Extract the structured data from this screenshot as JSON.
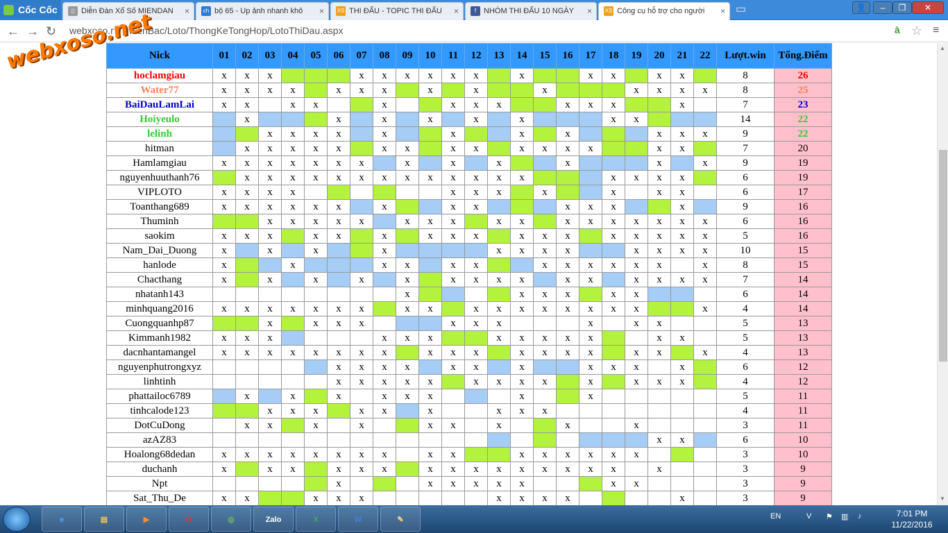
{
  "browser": {
    "logo": "Cốc Cốc",
    "tabs": [
      {
        "title": "Diễn Đàn Xổ Số MIENDAN",
        "icon": "page-icon"
      },
      {
        "title": "bộ 65 - Up ảnh nhanh khô",
        "icon": "ch-icon"
      },
      {
        "title": "THI ĐẤU - TOPIC THI ĐẤU",
        "icon": "xs-icon"
      },
      {
        "title": "NHÓM THI ĐẤU 10 NGÀY",
        "icon": "facebook-icon"
      },
      {
        "title": "Công cụ hỗ trợ cho người",
        "icon": "xs-icon"
      }
    ],
    "url": "webxoso.net/MienBac/Loto/ThongKeTongHop/LotoThiDau.aspx",
    "watermark": "webxoso.net"
  },
  "table": {
    "headers": [
      "Nick",
      "01",
      "02",
      "03",
      "04",
      "05",
      "06",
      "07",
      "08",
      "09",
      "10",
      "11",
      "12",
      "13",
      "14",
      "15",
      "16",
      "17",
      "18",
      "19",
      "20",
      "21",
      "22",
      "Lượt.win",
      "Tổng.Điểm"
    ],
    "rows": [
      {
        "nick": "hoclamgiau",
        "color": "#ff0000",
        "cells": "xxxgggxxxxxxgxggxxgxxg",
        "win": "8",
        "pts": "26"
      },
      {
        "nick": "Water77",
        "color": "#ff7f50",
        "cells": "xxxxgxxxgxgxggxgggxxxx",
        "win": "8",
        "pts": "25"
      },
      {
        "nick": "BaiDauLamLai",
        "color": "#0000cc",
        "cells": "xx xx gx gxxxggxxxggx",
        "win": "7",
        "pts": "23"
      },
      {
        "nick": "Hoiyeulo",
        "color": "#33cc33",
        "cells": "bxbbgxbxbxbxbxbbbxxgbb",
        "win": "14",
        "pts": "22"
      },
      {
        "nick": "lelinh",
        "color": "#33cc33",
        "cells": "bgxxxxbxbgxgbxgxbgbxxx",
        "win": "9",
        "pts": "22"
      },
      {
        "nick": "hitman",
        "color": "#000",
        "cells": "bxxxxxgxxgxxgxxxxggxxg",
        "win": "7",
        "pts": "20"
      },
      {
        "nick": "Hamlamgiau",
        "color": "#000",
        "cells": "xxxxxxxbxbxbxgbxbbbxbx",
        "win": "9",
        "pts": "19"
      },
      {
        "nick": "nguyenhuuthanh76",
        "color": "#000",
        "cells": "gxxxxxxxxxxxxxggbxxxxg",
        "win": "6",
        "pts": "19"
      },
      {
        "nick": "VIPLOTO",
        "color": "#000",
        "cells": "xxxx g g  xxxgxgbx xx",
        "win": "6",
        "pts": "17"
      },
      {
        "nick": "Toanthang689",
        "color": "#000",
        "cells": "xxxxxxbxgbxxbgbxxxbgxb",
        "win": "9",
        "pts": "16"
      },
      {
        "nick": "Thuminh",
        "color": "#000",
        "cells": "ggxxxxxbxxxgxxgxxxxxxx",
        "win": "6",
        "pts": "16"
      },
      {
        "nick": "saokim",
        "color": "#000",
        "cells": "xxxgxxgxgxxxgxxxgxxxxx",
        "win": "5",
        "pts": "16"
      },
      {
        "nick": "Nam_Dai_Duong",
        "color": "#000",
        "cells": "xbxbxbgxbbbbxxxxbbxxxx",
        "win": "10",
        "pts": "15"
      },
      {
        "nick": "hanlode",
        "color": "#000",
        "cells": "xgbxbbbxxbxxgbxxxxxx x",
        "win": "8",
        "pts": "15"
      },
      {
        "nick": "Chacthang",
        "color": "#000",
        "cells": "xgxbxbxbxgxxxxbxxbxxxx",
        "win": "7",
        "pts": "14"
      },
      {
        "nick": "nhatanh143",
        "color": "#000",
        "cells": "        xgb gxxxgxxbb",
        "win": "6",
        "pts": "14"
      },
      {
        "nick": "minhquang2016",
        "color": "#000",
        "cells": "xxxxxxxgxxgxxxxxxxxggx",
        "win": "4",
        "pts": "14"
      },
      {
        "nick": "Cuongquanhp87",
        "color": "#000",
        "cells": "ggxgxxx bbxxx   x xx",
        "win": "5",
        "pts": "13"
      },
      {
        "nick": "Kimmanh1982",
        "color": "#000",
        "cells": "xxxb   xxxggxxxxxg xx",
        "win": "5",
        "pts": "13"
      },
      {
        "nick": "dacnhantamangel",
        "color": "#000",
        "cells": "xxxxxxxxgxxxgxxxxgxxgx",
        "win": "4",
        "pts": "13"
      },
      {
        "nick": "nguyenphutrongxyz",
        "color": "#000",
        "cells": "    bxxxxbxxbxbbxxx xg",
        "win": "6",
        "pts": "12"
      },
      {
        "nick": "linhtinh",
        "color": "#000",
        "cells": "     xxxxxgxxxxgxgxxxg",
        "win": "4",
        "pts": "12"
      },
      {
        "nick": "phattailoc6789",
        "color": "#000",
        "cells": "bxbxgx xxx b x gx",
        "win": "5",
        "pts": "11"
      },
      {
        "nick": "tinhcalode123",
        "color": "#000",
        "cells": "ggxxxgxxbx  xxx",
        "win": "4",
        "pts": "11"
      },
      {
        "nick": "DotCuDong",
        "color": "#000",
        "cells": " xxgx x gxx x gx  x",
        "win": "3",
        "pts": "11"
      },
      {
        "nick": "azAZ83",
        "color": "#000",
        "cells": "            b g bbbxxb",
        "win": "6",
        "pts": "10"
      },
      {
        "nick": "Hoalong68dedan",
        "color": "#000",
        "cells": "xxxxxxxx xxggxxxxxx g",
        "win": "3",
        "pts": "10"
      },
      {
        "nick": "duchanh",
        "color": "#000",
        "cells": "xgxxgxxxgxxxxxxxxx x",
        "win": "3",
        "pts": "9"
      },
      {
        "nick": "Npt",
        "color": "#000",
        "cells": "    gx g xxxxx  gxx",
        "win": "3",
        "pts": "9"
      },
      {
        "nick": "Sat_Thu_De",
        "color": "#000",
        "cells": "xxggxxx     xxxx g  x",
        "win": "3",
        "pts": "9"
      }
    ]
  },
  "taskbar": {
    "apps": [
      "ie-icon",
      "explorer-icon",
      "media-icon",
      "opera-icon",
      "coccoc-icon",
      "zalo-icon",
      "excel-icon",
      "word-icon",
      "paint-icon"
    ],
    "lang": "EN",
    "time": "7:01 PM",
    "date": "11/22/2016"
  }
}
